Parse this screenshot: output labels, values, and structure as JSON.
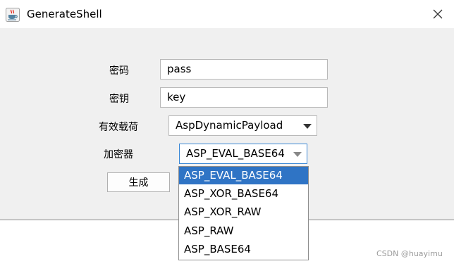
{
  "window": {
    "title": "GenerateShell",
    "icon": "java-coffee-cup-icon"
  },
  "form": {
    "password_label": "密码",
    "password_value": "pass",
    "key_label": "密钥",
    "key_value": "key",
    "payload_label": "有效载荷",
    "payload_value": "AspDynamicPayload",
    "encryptor_label": "加密器",
    "encryptor_value": "ASP_EVAL_BASE64",
    "generate_label": "生成"
  },
  "encryptor_dropdown": {
    "options": [
      "ASP_EVAL_BASE64",
      "ASP_XOR_BASE64",
      "ASP_XOR_RAW",
      "ASP_RAW",
      "ASP_BASE64"
    ],
    "selected": "ASP_EVAL_BASE64"
  },
  "watermark": "CSDN @huayimu",
  "colors": {
    "selection": "#2f74c5",
    "focus_border": "#3b88d6",
    "window_bg": "#f0f0f0"
  }
}
